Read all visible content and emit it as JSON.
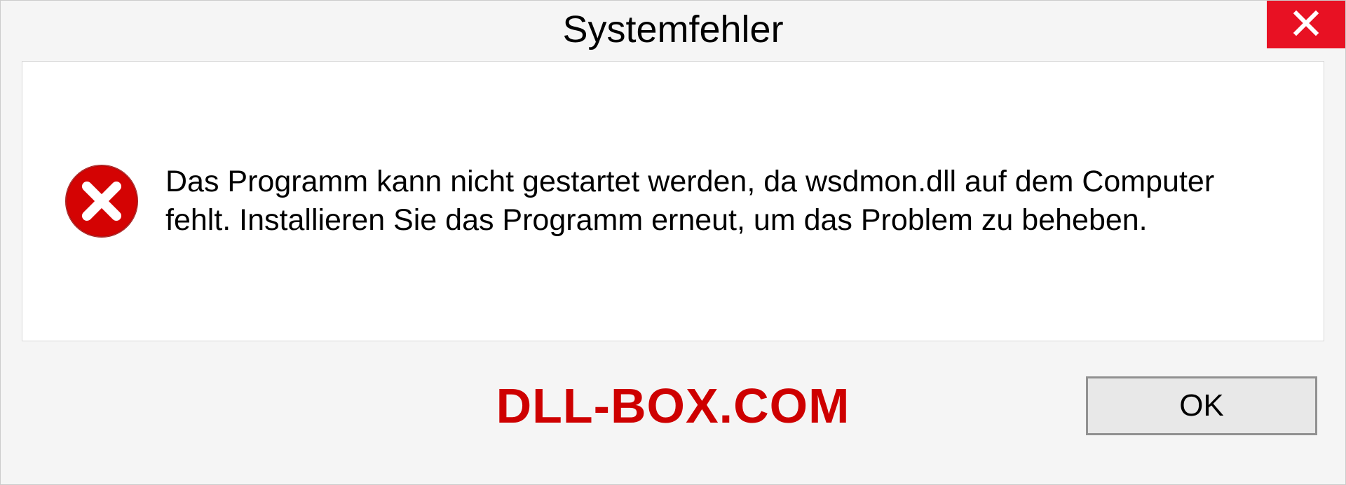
{
  "dialog": {
    "title": "Systemfehler",
    "message": "Das Programm kann nicht gestartet werden, da wsdmon.dll auf dem Computer fehlt. Installieren Sie das Programm erneut, um das Problem zu beheben.",
    "ok_label": "OK"
  },
  "watermark": "DLL-BOX.COM",
  "colors": {
    "close_button": "#e81123",
    "error_icon": "#d40303",
    "watermark": "#ce0000"
  }
}
